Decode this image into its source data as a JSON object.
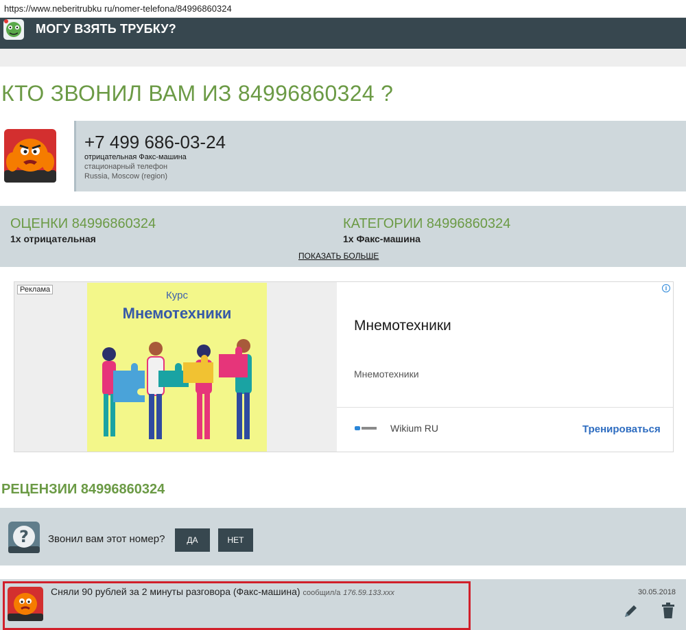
{
  "browser": {
    "url": "https://www.neberitrubku ru/nomer-telefona/84996860324"
  },
  "header": {
    "title": "МОГУ ВЗЯТЬ ТРУБКУ?"
  },
  "page": {
    "title": "КТО ЗВОНИЛ ВАМ ИЗ 84996860324 ?"
  },
  "number_info": {
    "formatted": "+7 499 686-03-24",
    "rating_line": "отрицательная Факс-машина",
    "line_type": "стационарный телефон",
    "region": "Russia, Moscow (region)"
  },
  "stats": {
    "ratings_title": "ОЦЕНКИ 84996860324",
    "ratings_value": "1x отрицательная",
    "categories_title": "КАТЕГОРИИ 84996860324",
    "categories_value": "1x Факс-машина",
    "show_more": "ПОКАЗАТЬ БОЛЬШЕ"
  },
  "ad": {
    "label": "Реклама",
    "image_caption_top": "Курс",
    "image_caption_main": "Мнемотехники",
    "title": "Мнемотехники",
    "description": "Мнемотехники",
    "source": "Wikium RU",
    "cta": "Тренироваться",
    "info_icon": "i"
  },
  "reviews": {
    "title": "РЕЦЕНЗИИ 84996860324",
    "ask_text": "Звонил вам этот номер?",
    "yes_label": "ДА",
    "no_label": "НЕТ",
    "items": [
      {
        "text": "Сняли 90 рублей за 2 минуты разговора (Факс-машина)",
        "meta": "сообщил/а",
        "ip": "176.59.133.xxx",
        "date": "30.05.2018"
      }
    ]
  },
  "colors": {
    "header_bg": "#37474f",
    "accent_green": "#6b9a45",
    "panel_bg": "#cfd8dc",
    "highlight_red": "#d11f2a",
    "cta_blue": "#2d6cc0"
  }
}
